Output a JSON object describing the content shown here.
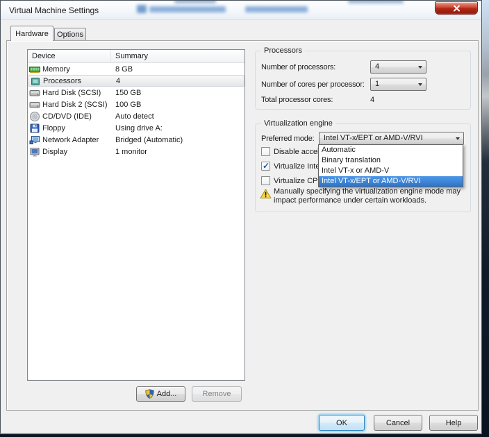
{
  "window": {
    "title": "Virtual Machine Settings",
    "close": "close"
  },
  "tabs": {
    "hardware": "Hardware",
    "options": "Options"
  },
  "device_list": {
    "columns": {
      "device": "Device",
      "summary": "Summary"
    },
    "rows": [
      {
        "icon": "memory-icon",
        "device": "Memory",
        "summary": "8 GB",
        "selected": false
      },
      {
        "icon": "processor-icon",
        "device": "Processors",
        "summary": "4",
        "selected": true
      },
      {
        "icon": "hard-disk-icon",
        "device": "Hard Disk (SCSI)",
        "summary": "150 GB",
        "selected": false
      },
      {
        "icon": "hard-disk-icon",
        "device": "Hard Disk 2 (SCSI)",
        "summary": "100 GB",
        "selected": false
      },
      {
        "icon": "cd-dvd-icon",
        "device": "CD/DVD (IDE)",
        "summary": "Auto detect",
        "selected": false
      },
      {
        "icon": "floppy-icon",
        "device": "Floppy",
        "summary": "Using drive A:",
        "selected": false
      },
      {
        "icon": "network-adapter-icon",
        "device": "Network Adapter",
        "summary": "Bridged (Automatic)",
        "selected": false
      },
      {
        "icon": "display-icon",
        "device": "Display",
        "summary": "1 monitor",
        "selected": false
      }
    ]
  },
  "processors_group": {
    "title": "Processors",
    "rows": [
      {
        "label": "Number of processors:",
        "value": "4"
      },
      {
        "label": "Number of cores per processor:",
        "value": "1"
      },
      {
        "label": "Total processor cores:",
        "value": "4"
      }
    ]
  },
  "virtualization_group": {
    "title": "Virtualization engine",
    "preferred_mode_label": "Preferred mode:",
    "preferred_mode_value": "Intel VT-x/EPT or AMD-V/RVI",
    "checkboxes": [
      {
        "label": "Disable acceler",
        "checked": false
      },
      {
        "label": "Virtualize Intel",
        "checked": true
      },
      {
        "label": "Virtualize CPU ",
        "checked": false
      }
    ],
    "dropdown_options": [
      {
        "label": "Automatic",
        "selected": false
      },
      {
        "label": "Binary translation",
        "selected": false
      },
      {
        "label": "Intel VT-x or AMD-V",
        "selected": false
      },
      {
        "label": "Intel VT-x/EPT or AMD-V/RVI",
        "selected": true
      }
    ],
    "warning_line1": "Manually specifying the virtualization engine mode may",
    "warning_line2": "impact performance under certain workloads."
  },
  "buttons": {
    "add": "Add...",
    "remove": "Remove",
    "ok": "OK",
    "cancel": "Cancel",
    "help": "Help"
  },
  "colors": {
    "selection_blue": "#3a87d8",
    "close_button_red": "#b52a18",
    "warning_yellow": "#ffd83b",
    "dialog_background": "#f0f0f0"
  }
}
